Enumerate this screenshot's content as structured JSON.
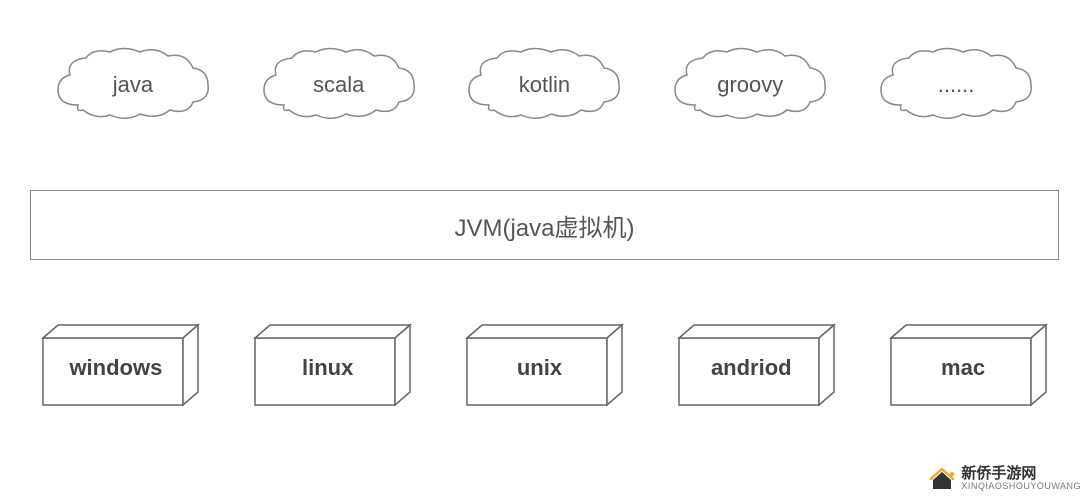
{
  "languages": {
    "items": [
      "java",
      "scala",
      "kotlin",
      "groovy",
      "......"
    ]
  },
  "jvm": {
    "label": "JVM(java虚拟机)"
  },
  "platforms": {
    "items": [
      "windows",
      "linux",
      "unix",
      "andriod",
      "mac"
    ]
  },
  "watermark": {
    "title": "新侨手游网",
    "subtitle": "XINQIAOSHOUYOUWANG"
  }
}
